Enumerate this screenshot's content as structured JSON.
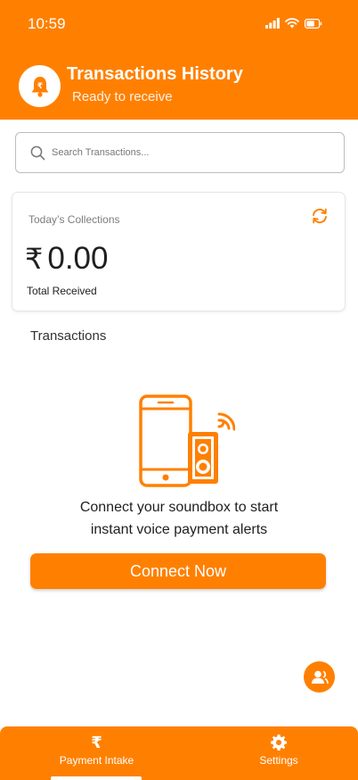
{
  "status_bar": {
    "time": "10:59"
  },
  "header": {
    "title": "Transactions History",
    "subtitle": "Ready to receive",
    "brand_color": "#FF8000"
  },
  "search": {
    "placeholder": "Search Transactions..."
  },
  "collections_card": {
    "label": "Today’s Collections",
    "currency_symbol": "₹",
    "amount": "0.00",
    "total_label": "Total Received"
  },
  "transactions": {
    "heading": "Transactions"
  },
  "empty_state": {
    "message_line1": "Connect your soundbox to start",
    "message_line2": "instant voice payment alerts",
    "button_label": "Connect Now"
  },
  "bottom_nav": {
    "items": [
      {
        "label": "Payment Intake",
        "icon": "rupee-icon",
        "icon_glyph": "₹",
        "active": true
      },
      {
        "label": "Settings",
        "icon": "gear-icon",
        "active": false
      }
    ]
  }
}
